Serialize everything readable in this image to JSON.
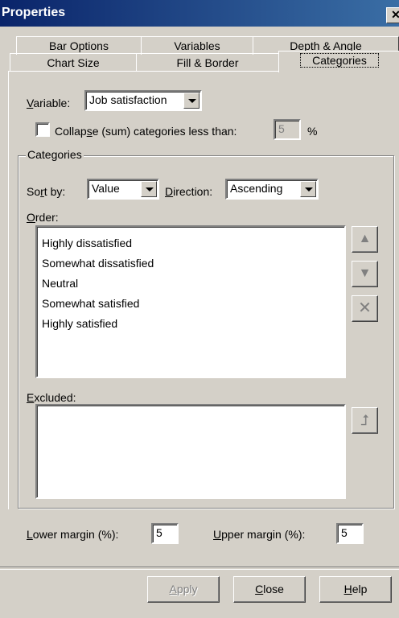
{
  "window": {
    "title": "Properties",
    "close_glyph": "✕"
  },
  "tabs_row1": [
    "Bar Options",
    "Variables",
    "Depth & Angle"
  ],
  "tabs_row2": [
    "Chart Size",
    "Fill & Border",
    "Categories"
  ],
  "active_tab": "Categories",
  "variable": {
    "label": "Variable:",
    "accel": "V",
    "rest": "ariable:",
    "value": "Job satisfaction"
  },
  "collapse": {
    "label_pre": "Collap",
    "label_accel": "s",
    "label_post": "e (sum) categories less than:",
    "checked": false,
    "value": "5",
    "unit": "%"
  },
  "categories_group": {
    "title": "Categories",
    "sort_by": {
      "pre": "So",
      "accel": "r",
      "post": "t by:",
      "value": "Value"
    },
    "direction": {
      "accel": "D",
      "post": "irection:",
      "value": "Ascending"
    },
    "order": {
      "accel": "O",
      "post": "rder:",
      "items": [
        "Highly dissatisfied",
        "Somewhat dissatisfied",
        "Neutral",
        "Somewhat satisfied",
        "Highly satisfied"
      ]
    },
    "excluded": {
      "accel": "E",
      "post": "xcluded:",
      "items": []
    }
  },
  "margins": {
    "lower": {
      "accel": "L",
      "post": "ower margin (%):",
      "value": "5"
    },
    "upper": {
      "accel": "U",
      "post": "pper margin (%):",
      "value": "5"
    }
  },
  "buttons": {
    "apply": {
      "accel": "A",
      "post": "pply",
      "enabled": false
    },
    "close": {
      "accel": "C",
      "post": "lose"
    },
    "help": {
      "accel": "H",
      "post": "elp"
    }
  },
  "icons": {
    "move_up": "triangle-up-icon",
    "move_down": "triangle-down-icon",
    "remove": "x-icon",
    "restore": "return-arrow-icon"
  }
}
